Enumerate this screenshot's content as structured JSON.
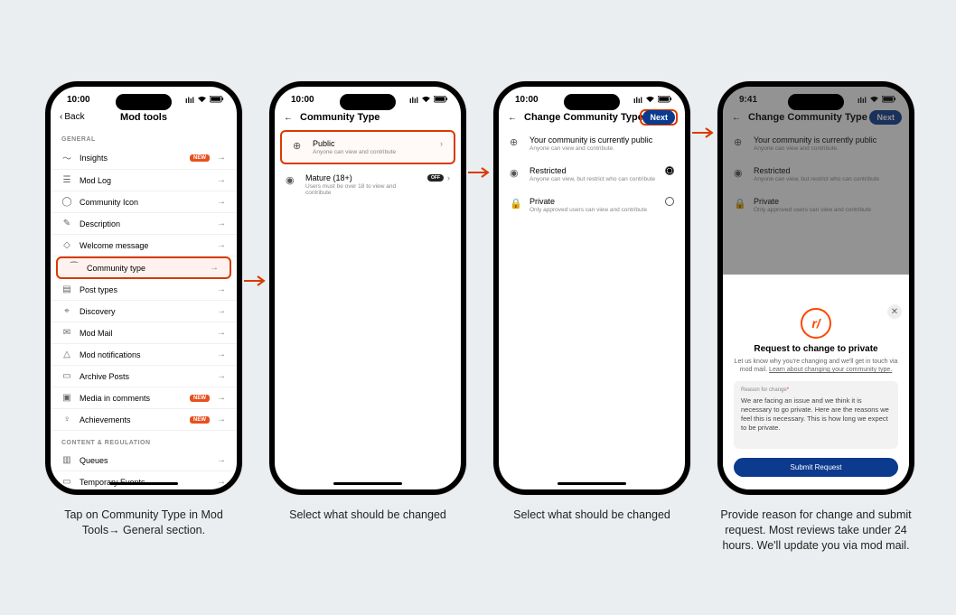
{
  "phone1": {
    "time": "10:00",
    "back": "Back",
    "title": "Mod tools",
    "sections": [
      {
        "header": "GENERAL",
        "items": [
          {
            "icon": "chart-icon",
            "glyph": "〜",
            "label": "Insights",
            "badge": "NEW"
          },
          {
            "icon": "list-icon",
            "glyph": "☰",
            "label": "Mod Log"
          },
          {
            "icon": "circle-icon",
            "glyph": "◯",
            "label": "Community Icon"
          },
          {
            "icon": "pencil-icon",
            "glyph": "✎",
            "label": "Description"
          },
          {
            "icon": "chat-icon",
            "glyph": "◇",
            "label": "Welcome message"
          },
          {
            "icon": "lock-icon",
            "glyph": "⁀",
            "label": "Community type",
            "highlight": true
          },
          {
            "icon": "note-icon",
            "glyph": "▤",
            "label": "Post types"
          },
          {
            "icon": "compass-icon",
            "glyph": "⌖",
            "label": "Discovery"
          },
          {
            "icon": "mail-icon",
            "glyph": "✉",
            "label": "Mod Mail"
          },
          {
            "icon": "bell-icon",
            "glyph": "△",
            "label": "Mod notifications"
          },
          {
            "icon": "archive-icon",
            "glyph": "▭",
            "label": "Archive Posts"
          },
          {
            "icon": "media-icon",
            "glyph": "▣",
            "label": "Media in comments",
            "badge": "NEW"
          },
          {
            "icon": "trophy-icon",
            "glyph": "♀",
            "label": "Achievements",
            "badge": "NEW"
          }
        ]
      },
      {
        "header": "CONTENT & REGULATION",
        "items": [
          {
            "icon": "queue-icon",
            "glyph": "▥",
            "label": "Queues"
          },
          {
            "icon": "calendar-icon",
            "glyph": "▭",
            "label": "Temporary Events"
          }
        ]
      }
    ]
  },
  "phone2": {
    "time": "10:00",
    "title": "Community Type",
    "options": [
      {
        "icon": "globe-icon",
        "glyph": "⊕",
        "title": "Public",
        "sub": "Anyone can view and contribute",
        "chevron": true,
        "highlight": true
      },
      {
        "icon": "eye-icon",
        "glyph": "◉",
        "title": "Mature (18+)",
        "sub": "Users must be over 18 to view and contribute",
        "off": true,
        "chevron": true
      }
    ]
  },
  "phone3": {
    "time": "10:00",
    "title": "Change Community Type",
    "next": "Next",
    "options": [
      {
        "icon": "globe-icon",
        "glyph": "⊕",
        "title": "Your community is currently public",
        "sub": "Anyone can view and contribute."
      },
      {
        "icon": "eye-icon",
        "glyph": "◉",
        "title": "Restricted",
        "sub": "Anyone can view, but restrict who can contribute",
        "radio": true,
        "selected": true
      },
      {
        "icon": "lock-icon",
        "glyph": "🔒",
        "title": "Private",
        "sub": "Only approved users can view and contribute",
        "radio": true,
        "selected": false
      }
    ]
  },
  "phone4": {
    "time": "9:41",
    "title": "Change Community Type",
    "next": "Next",
    "options": [
      {
        "icon": "globe-icon",
        "glyph": "⊕",
        "title": "Your community is currently public",
        "sub": "Anyone can view and contribute."
      },
      {
        "icon": "eye-icon",
        "glyph": "◉",
        "title": "Restricted",
        "sub": "Anyone can view, but restrict who can contribute"
      },
      {
        "icon": "lock-icon",
        "glyph": "🔒",
        "title": "Private",
        "sub": "Only approved users can view and contribute"
      }
    ],
    "sheet": {
      "heading": "Request to change to private",
      "desc1": "Let us know why you're changing and we'll get in touch via mod mail. ",
      "desc_link": "Learn about changing your community type.",
      "reason_label": "Reason for change",
      "reason_text": "We are facing an issue and we think it is necessary to go private. Here are the reasons we feel this is necessary. This is how long we expect to be private.",
      "submit": "Submit Request"
    }
  },
  "captions": {
    "c1": "Tap on Community Type in Mod Tools→ General section.",
    "c2": "Select what should be changed",
    "c3": "Select what should be changed",
    "c4": "Provide reason for change and submit request. Most reviews take under 24 hours. We'll update you via mod mail."
  },
  "off_label": "OFF"
}
